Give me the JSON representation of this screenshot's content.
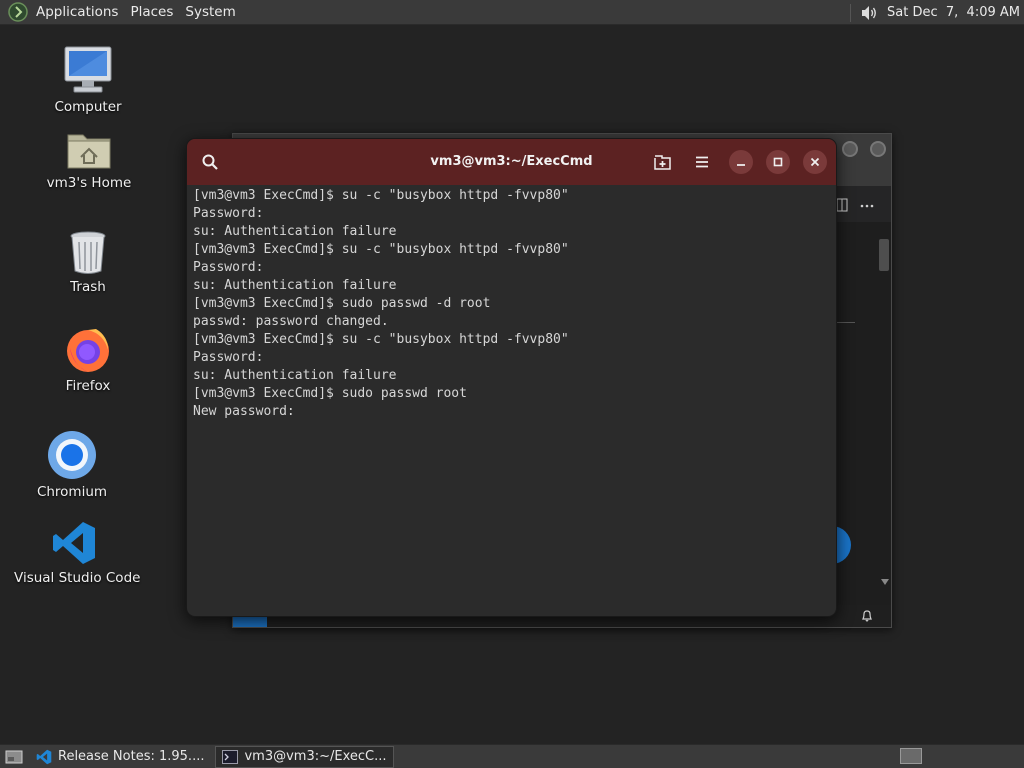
{
  "top_panel": {
    "menus": [
      "Applications",
      "Places",
      "System"
    ],
    "clock": "Sat Dec  7,  4:09 AM"
  },
  "desktop_icons": [
    {
      "label": "Computer"
    },
    {
      "label": "vm3's Home"
    },
    {
      "label": "Trash"
    },
    {
      "label": "Firefox"
    },
    {
      "label": "Chromium"
    },
    {
      "label": "Visual Studio Code"
    }
  ],
  "terminal": {
    "title": "vm3@vm3:~/ExecCmd",
    "lines": [
      "[vm3@vm3 ExecCmd]$ su -c \"busybox httpd -fvvp80\"",
      "Password:",
      "su: Authentication failure",
      "[vm3@vm3 ExecCmd]$ su -c \"busybox httpd -fvvp80\"",
      "Password:",
      "su: Authentication failure",
      "[vm3@vm3 ExecCmd]$ sudo passwd -d root",
      "passwd: password changed.",
      "[vm3@vm3 ExecCmd]$ su -c \"busybox httpd -fvvp80\"",
      "Password:",
      "su: Authentication failure",
      "[vm3@vm3 ExecCmd]$ sudo passwd root",
      "New password:"
    ]
  },
  "taskbar": {
    "tasks": [
      {
        "label": "Release Notes: 1.95....",
        "icon": "vscode-icon",
        "active": false
      },
      {
        "label": "vm3@vm3:~/ExecC...",
        "icon": "terminal-icon",
        "active": true
      }
    ]
  },
  "colors": {
    "terminal_header": "#5c2222",
    "desktop_bg": "#232323",
    "panel_bg": "#3a3a3a"
  }
}
